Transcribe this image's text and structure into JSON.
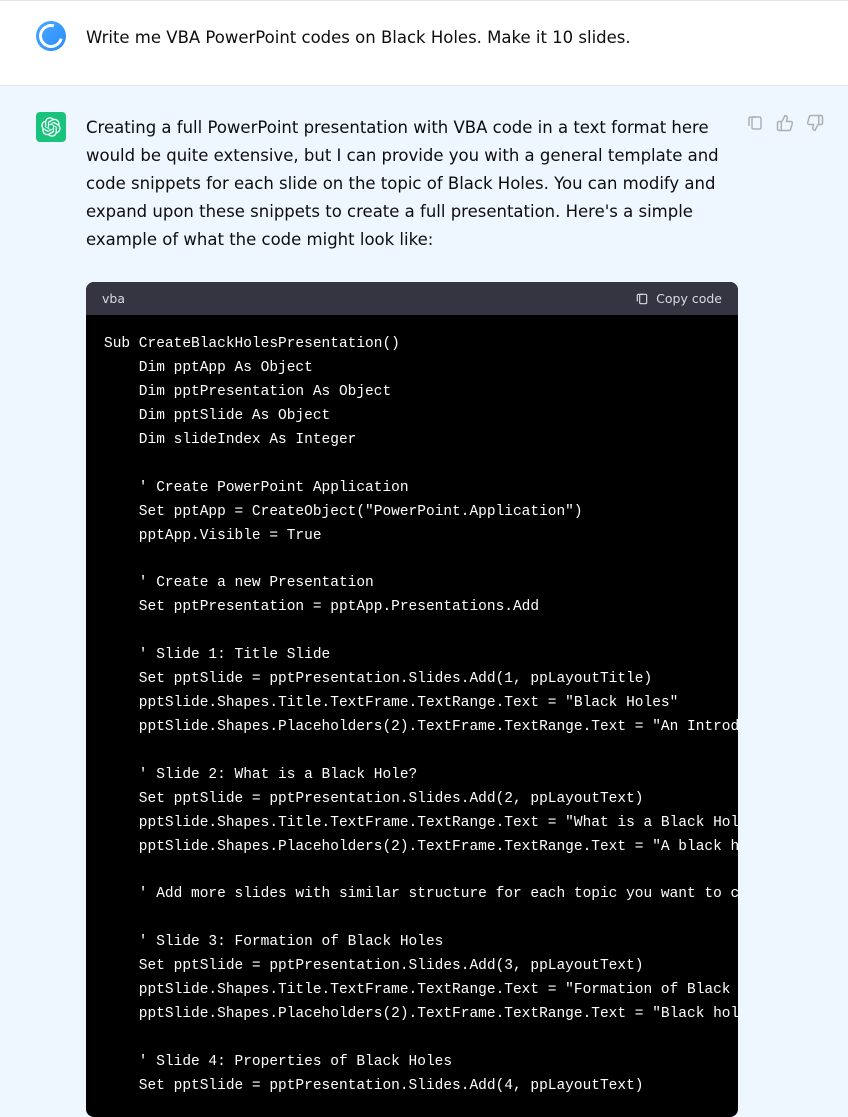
{
  "user": {
    "message": "Write me VBA PowerPoint codes on Black Holes. Make it 10 slides."
  },
  "assistant": {
    "intro": "Creating a full PowerPoint presentation with VBA code in a text format here would be quite extensive, but I can provide you with a general template and code snippets for each slide on the topic of Black Holes. You can modify and expand upon these snippets to create a full presentation. Here's a simple example of what the code might look like:"
  },
  "code": {
    "language": "vba",
    "copy_label": "Copy code",
    "content": "Sub CreateBlackHolesPresentation()\n    Dim pptApp As Object\n    Dim pptPresentation As Object\n    Dim pptSlide As Object\n    Dim slideIndex As Integer\n\n    ' Create PowerPoint Application\n    Set pptApp = CreateObject(\"PowerPoint.Application\")\n    pptApp.Visible = True\n\n    ' Create a new Presentation\n    Set pptPresentation = pptApp.Presentations.Add\n\n    ' Slide 1: Title Slide\n    Set pptSlide = pptPresentation.Slides.Add(1, ppLayoutTitle)\n    pptSlide.Shapes.Title.TextFrame.TextRange.Text = \"Black Holes\"\n    pptSlide.Shapes.Placeholders(2).TextFrame.TextRange.Text = \"An Introduction\"\n\n    ' Slide 2: What is a Black Hole?\n    Set pptSlide = pptPresentation.Slides.Add(2, ppLayoutText)\n    pptSlide.Shapes.Title.TextFrame.TextRange.Text = \"What is a Black Hole?\"\n    pptSlide.Shapes.Placeholders(2).TextFrame.TextRange.Text = \"A black hole is...\"\n\n    ' Add more slides with similar structure for each topic you want to cover\n\n    ' Slide 3: Formation of Black Holes\n    Set pptSlide = pptPresentation.Slides.Add(3, ppLayoutText)\n    pptSlide.Shapes.Title.TextFrame.TextRange.Text = \"Formation of Black Holes\"\n    pptSlide.Shapes.Placeholders(2).TextFrame.TextRange.Text = \"Black holes form...\"\n\n    ' Slide 4: Properties of Black Holes\n    Set pptSlide = pptPresentation.Slides.Add(4, ppLayoutText)"
  }
}
